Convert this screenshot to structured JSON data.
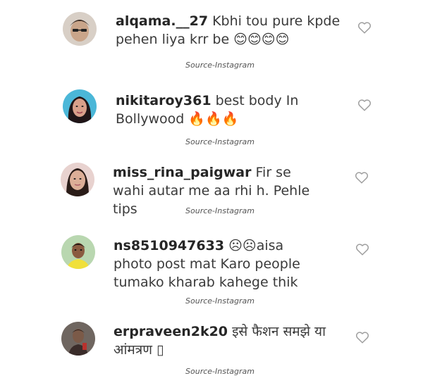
{
  "comments": [
    {
      "username": "alqama.__27",
      "text": "Kbhi tou pure kpde pehen liya krr be 😊😊😊😊",
      "source": "Source-Instagram",
      "colors": {
        "skin": "#c9a58a",
        "hair": "#3b2b22",
        "bg": "#d8cfc6"
      }
    },
    {
      "username": "nikitaroy361",
      "text": "best body In Bollywood 🔥🔥🔥",
      "source": "Source-Instagram",
      "colors": {
        "skin": "#d9a08a",
        "hair": "#201517",
        "bg": "#4bb7d8"
      }
    },
    {
      "username": "miss_rina_paigwar",
      "text": "Fir se wahi autar me aa rhi h. Pehle tips",
      "source": "Source-Instagram",
      "colors": {
        "skin": "#dcae97",
        "hair": "#2a1c18",
        "bg": "#e8d2cf"
      }
    },
    {
      "username": "ns8510947633",
      "text": "☹☹aisa photo post mat Karo people tumako kharab kahege thik",
      "source": "Source-Instagram",
      "colors": {
        "skin": "#8a5b40",
        "hair": "#1e1512",
        "bg": "#b9d7b0",
        "shirt": "#f0e03a"
      }
    },
    {
      "username": "erpraveen2k20",
      "text": "इसे फैशन समझे या आंमत्रण ▯",
      "source": "Source-Instagram",
      "colors": {
        "skin": "#7b5a48",
        "hair": "#231816",
        "bg": "#6f6660"
      }
    }
  ],
  "icons": {
    "like": "heart-outline-icon"
  },
  "colors": {
    "text": "#3a3a3a",
    "username": "#262626",
    "heart": "#9e9e9e"
  }
}
